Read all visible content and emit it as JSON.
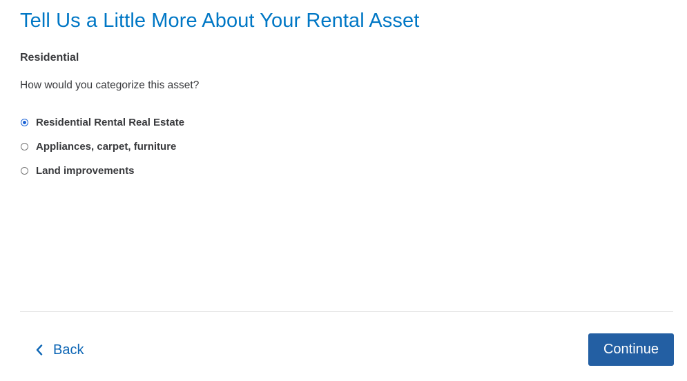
{
  "header": {
    "title": "Tell Us a Little More About Your Rental Asset"
  },
  "section": {
    "subheading": "Residential",
    "question": "How would you categorize this asset?"
  },
  "options": [
    {
      "label": "Residential Rental Real Estate",
      "selected": true
    },
    {
      "label": "Appliances, carpet, furniture",
      "selected": false
    },
    {
      "label": "Land improvements",
      "selected": false
    }
  ],
  "footer": {
    "back_label": "Back",
    "continue_label": "Continue"
  },
  "colors": {
    "title": "#0077c5",
    "primary_button": "#235fa3",
    "link": "#0d66b5",
    "radio_selected": "#1a62d6"
  },
  "icons": {
    "back": "chevron-left-icon"
  }
}
